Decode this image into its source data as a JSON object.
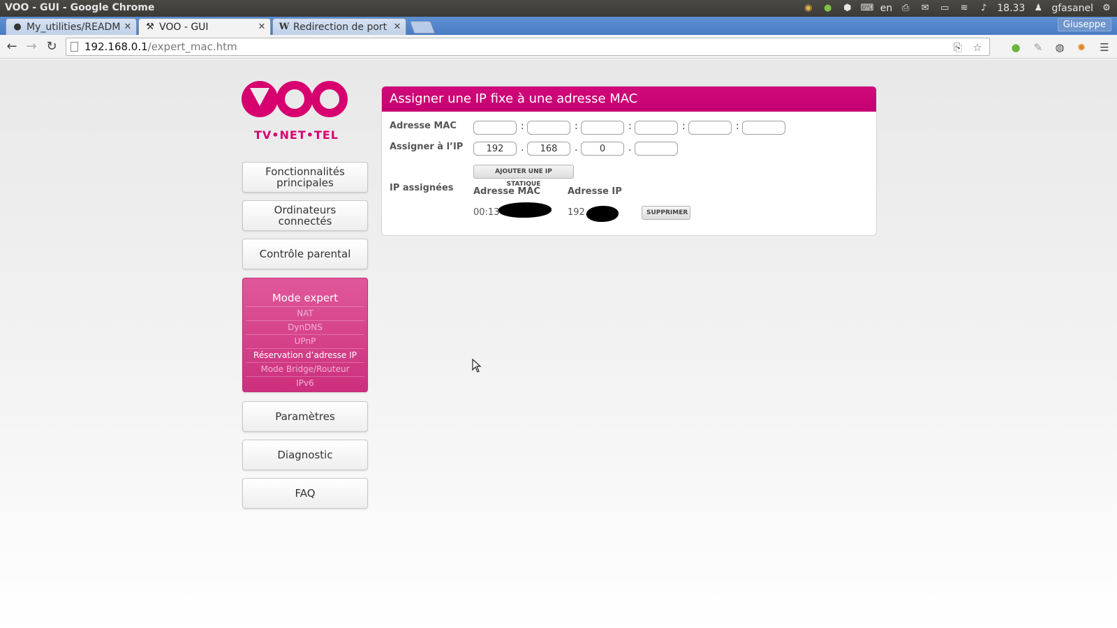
{
  "os_panel": {
    "window_title": "VOO - GUI - Google Chrome",
    "language": "en",
    "clock": "18.33",
    "user": "gfasanel"
  },
  "browser": {
    "tabs": [
      {
        "label": "My_utilities/READM",
        "icon": "github-icon",
        "active": false
      },
      {
        "label": "VOO - GUI",
        "icon": "tools-icon",
        "active": true
      },
      {
        "label": "Redirection de port",
        "icon": "wikipedia-icon",
        "active": false
      }
    ],
    "profile_name": "Giuseppe",
    "url_host": "192.168.0.1",
    "url_path": "/expert_mac.htm"
  },
  "logo": {
    "tagline": "TV•NET•TEL",
    "brand_color": "#d6006f"
  },
  "nav": {
    "items": [
      {
        "label": "Fonctionnalités principales"
      },
      {
        "label": "Ordinateurs connectés"
      },
      {
        "label": "Contrôle parental"
      },
      {
        "label": "Paramètres"
      },
      {
        "label": "Diagnostic"
      },
      {
        "label": "FAQ"
      }
    ],
    "expert": {
      "title": "Mode expert",
      "items": [
        {
          "label": "NAT"
        },
        {
          "label": "DynDNS"
        },
        {
          "label": "UPnP"
        },
        {
          "label": "Réservation d’adresse IP",
          "current": true
        },
        {
          "label": "Mode Bridge/Routeur"
        },
        {
          "label": "IPv6"
        }
      ]
    }
  },
  "panel": {
    "title": "Assigner une IP fixe à une adresse MAC",
    "mac_label": "Adresse MAC",
    "ip_label": "Assigner à l’IP",
    "ip_values": [
      "192",
      "168",
      "0",
      ""
    ],
    "mac_values": [
      "",
      "",
      "",
      "",
      "",
      ""
    ],
    "add_button": "AJOUTER UNE IP STATIQUE",
    "assigned_label": "IP assignées",
    "col_mac": "Adresse MAC",
    "col_ip": "Adresse IP",
    "rows": [
      {
        "mac": "00:13",
        "ip": "192.",
        "delete_label": "SUPPRIMER"
      }
    ]
  }
}
